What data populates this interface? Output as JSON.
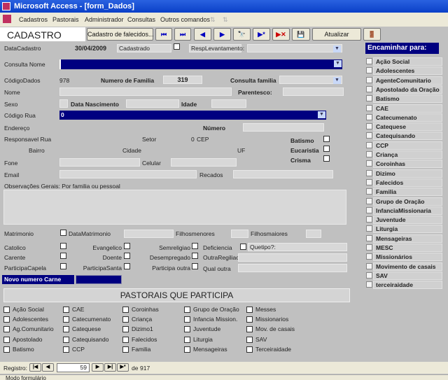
{
  "window": {
    "title": "Microsoft Access - [form_Dados]"
  },
  "menu": [
    "Cadastros",
    "Pastorais",
    "Administrador",
    "Consultas",
    "Outros comandos"
  ],
  "toolbar": {
    "form_title": "CADASTRO",
    "falecidos": "Cadastro de falecidos...",
    "atualizar": "Atualizar",
    "icons": [
      "first-record-icon",
      "last-record-icon",
      "prev-record-icon",
      "next-record-icon",
      "binoculars-icon",
      "new-record-icon",
      "delete-record-icon",
      "save-icon"
    ]
  },
  "form": {
    "data_cadastro_label": "DataCadastro",
    "data_cadastro": "30/04/2009",
    "cadastrado_label": "Cadastrado",
    "resp_label": "RespLevantamento:",
    "consulta_nome_label": "Consulta Nome",
    "codigo_label": "CódigoDados",
    "codigo": "978",
    "num_familia_label": "Numero de Familia",
    "num_familia": "319",
    "consulta_familia_label": "Consulta familia",
    "nome_label": "Nome",
    "parentesco_label": "Parentesco:",
    "sexo_label": "Sexo",
    "nasc_label": "Data Nascimento",
    "idade_label": "Idade",
    "codigo_rua_label": "Código Rua",
    "codigo_rua": "0",
    "endereco_label": "Endereço",
    "numero_label": "Número",
    "resp_rua_label": "Responsavel Rua",
    "setor_label": "Setor",
    "setor": "0",
    "cep_label": "CEP",
    "bairro_label": "Bairro",
    "cidade_label": "Cidade",
    "uf_label": "UF",
    "batismo_label": "Batismo",
    "eucaristia_label": "Eucaristia",
    "crisma_label": "Crisma",
    "fone_label": "Fone",
    "celular_label": "Celular",
    "email_label": "Email",
    "recados_label": "Recados",
    "obs_label": "Observações Gerais: Por familia ou pessoal",
    "matrimonio_label": "Matrimonio",
    "datamatrimonio_label": "DataMatrimonio",
    "filhosmenores_label": "Filhosmenores",
    "filhosmaiores_label": "Filhosmaiores",
    "catolico_label": "Catolico",
    "evangelico_label": "Evangelico",
    "semreligiao_label": "Semreligiao",
    "deficiencia_label": "Deficiencia",
    "quetipo_label": "Quetipo?:",
    "carente_label": "Carente",
    "doente_label": "Doente",
    "desempregado_label": "Desempregado",
    "outrareligiao_label": "OutraRegiliao",
    "participacapela_label": "ParticipaCapela",
    "participasanta_label": "ParticipaSanta",
    "participaoutra_label": "Participa outra",
    "qualoutra_label": "Qual outra",
    "novo_carne_label": "Novo numero Carne"
  },
  "pastorais": {
    "title": "PASTORAIS QUE PARTICIPA",
    "columns": [
      [
        "Ação Social",
        "Adolescentes",
        "Ag.Comunitario",
        "Apostolado",
        "Batismo"
      ],
      [
        "CAE",
        "Catecumenato",
        "Catequese",
        "Catequisando",
        "CCP"
      ],
      [
        "Coroinhas",
        "Criança",
        "Dizimo1",
        "Falecidos",
        "Familia"
      ],
      [
        "Grupo de Oração",
        "Infancia Mission.",
        "Juventude",
        "Liturgia",
        "Mensageiras"
      ],
      [
        "Messes",
        "Missionarios",
        "Mov. de casais",
        "SAV",
        "Terceiraidade"
      ]
    ]
  },
  "encaminhar": {
    "title": "Encaminhar para:",
    "items": [
      "Ação Social",
      "Adolescentes",
      "AgenteComunitario",
      "Apostolado da Oração",
      "Batismo",
      "CAE",
      "Catecumenato",
      "Catequese",
      "Catequisando",
      "CCP",
      "Criança",
      "Coroinhas",
      "Dizimo",
      "Falecidos",
      "Familia",
      "Grupo de Oração",
      "InfanciaMissionaria",
      "Juventude",
      "Liturgia",
      "Mensageiras",
      "MESC",
      "Missionários",
      "Movimento de casais",
      "SAV",
      "terceiraidade"
    ]
  },
  "nav": {
    "label": "Registro:",
    "current": "59",
    "of": "de",
    "total": "917"
  },
  "status": "Modo formulário"
}
